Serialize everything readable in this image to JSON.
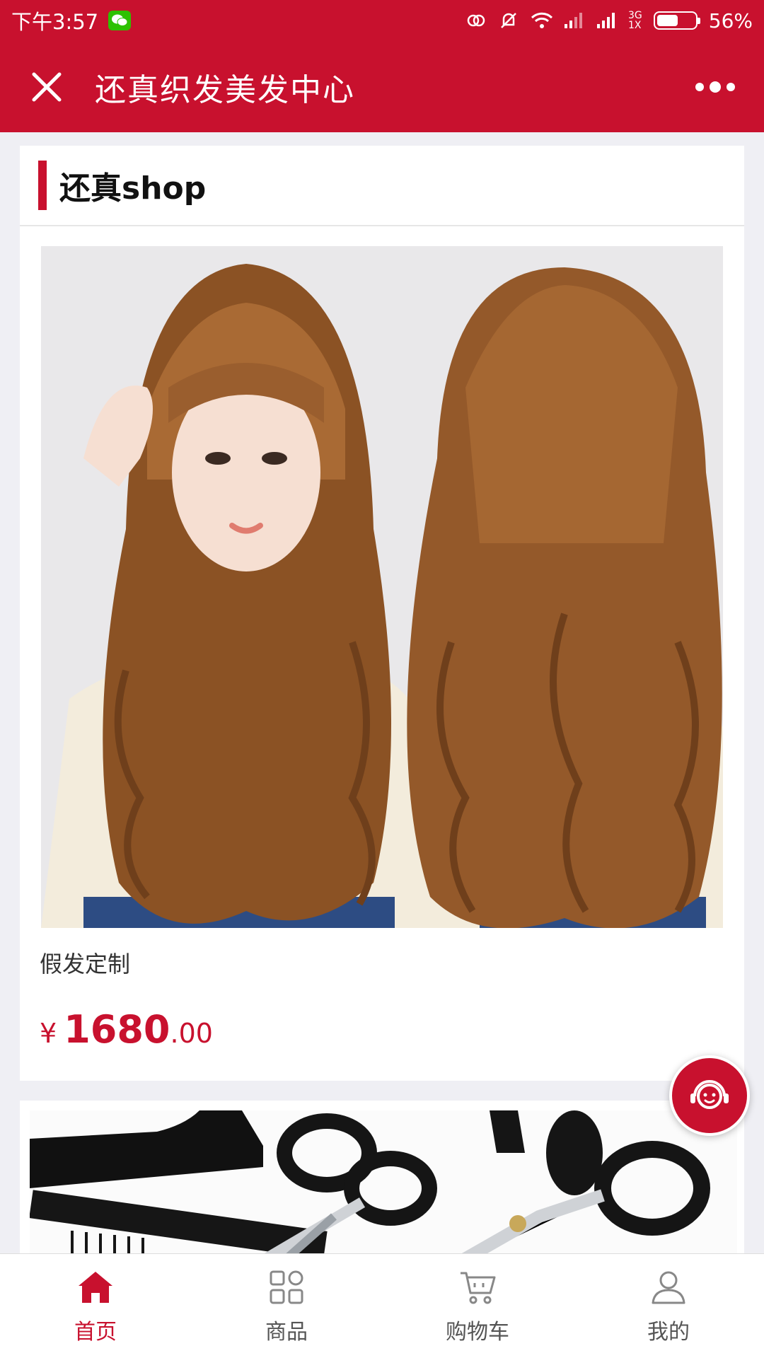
{
  "status_bar": {
    "time": "下午3:57",
    "battery": "56%",
    "battery_level": 0.56,
    "network": "3G",
    "sim": "1X"
  },
  "header": {
    "title": "还真织发美发中心"
  },
  "shop": {
    "title": "还真shop"
  },
  "products": [
    {
      "name": "假发定制",
      "currency": "¥",
      "price_int": "1680",
      "price_dec": ".00"
    }
  ],
  "tabs": [
    {
      "label": "首页",
      "icon": "home-icon",
      "active": true
    },
    {
      "label": "商品",
      "icon": "grid-icon",
      "active": false
    },
    {
      "label": "购物车",
      "icon": "cart-icon",
      "active": false
    },
    {
      "label": "我的",
      "icon": "user-icon",
      "active": false
    }
  ],
  "colors": {
    "brand": "#c8112e",
    "background": "#efeff4",
    "wechat": "#2dc100"
  }
}
